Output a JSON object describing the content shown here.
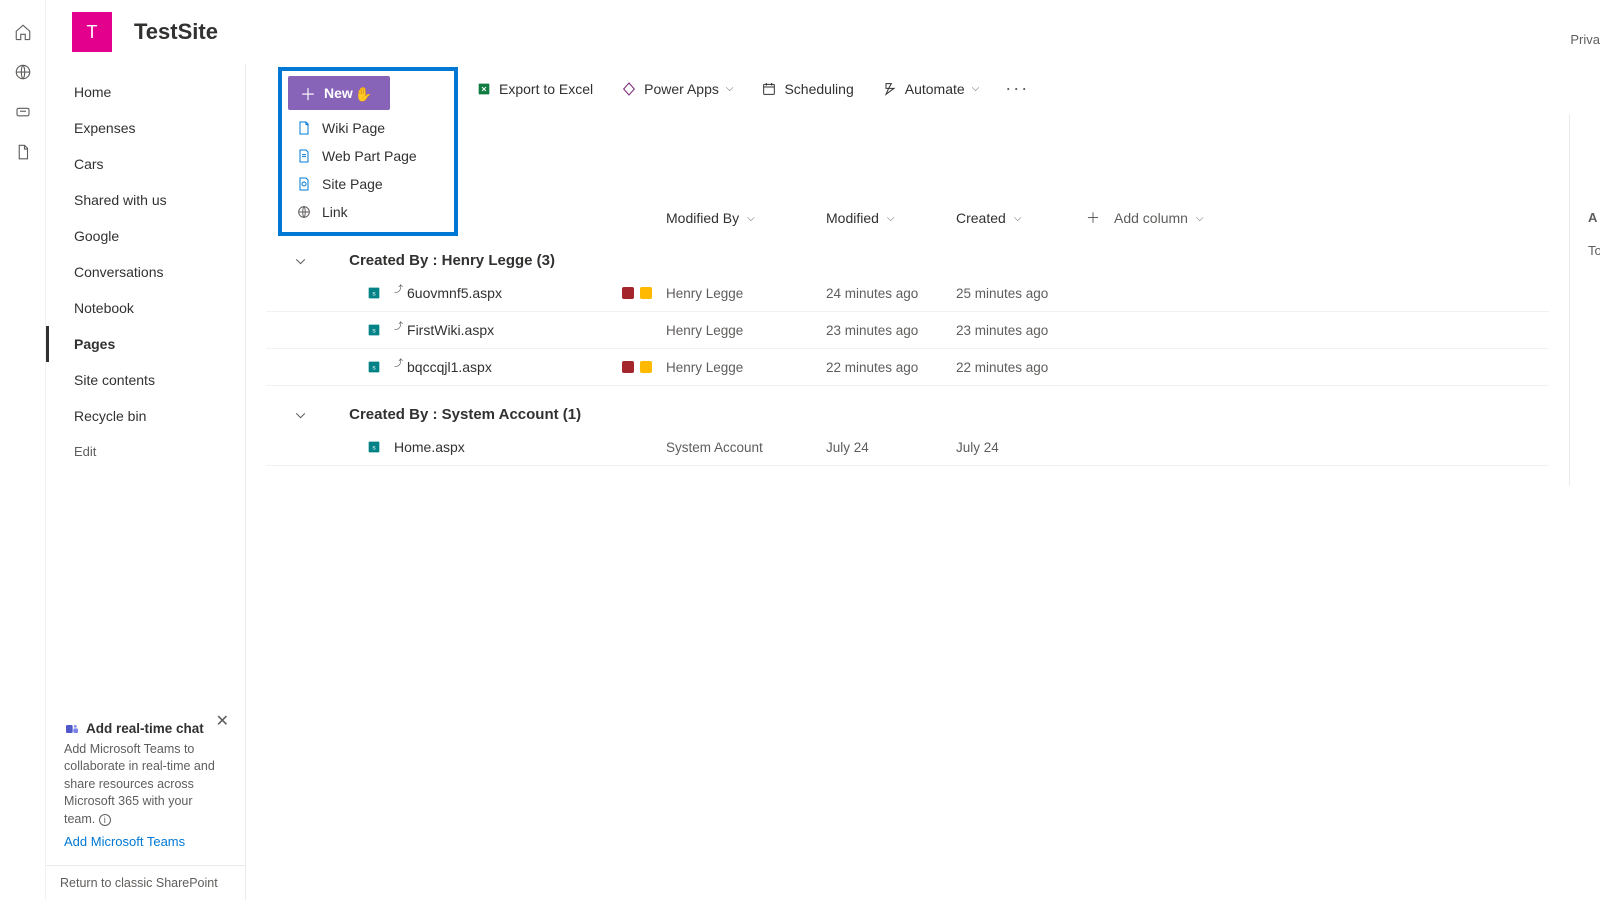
{
  "header": {
    "logo_letter": "T",
    "site_title": "TestSite",
    "privacy": "Priva"
  },
  "rail_icons": [
    "home",
    "globe",
    "link",
    "file"
  ],
  "sidebar": {
    "items": [
      {
        "label": "Home"
      },
      {
        "label": "Expenses"
      },
      {
        "label": "Cars"
      },
      {
        "label": "Shared with us"
      },
      {
        "label": "Google"
      },
      {
        "label": "Conversations"
      },
      {
        "label": "Notebook"
      },
      {
        "label": "Pages",
        "selected": true
      },
      {
        "label": "Site contents"
      },
      {
        "label": "Recycle bin"
      }
    ],
    "edit": "Edit",
    "tip_title": "Add real-time chat",
    "tip_body": "Add Microsoft Teams to collaborate in real-time and share resources across Microsoft 365 with your team.",
    "tip_link": "Add Microsoft Teams",
    "classic": "Return to classic SharePoint"
  },
  "cmd": {
    "new": "New",
    "excel": "Export to Excel",
    "powerapps": "Power Apps",
    "scheduling": "Scheduling",
    "automate": "Automate"
  },
  "new_menu": [
    {
      "label": "Wiki Page"
    },
    {
      "label": "Web Part Page"
    },
    {
      "label": "Site Page"
    },
    {
      "label": "Link"
    }
  ],
  "columns": {
    "name": "",
    "modified_by": "Modified By",
    "modified": "Modified",
    "created": "Created",
    "add": "Add column"
  },
  "groups": [
    {
      "header": "Created By : Henry Legge (3)",
      "rows": [
        {
          "file": "6uovmnf5.aspx",
          "by": "Henry Legge",
          "mod": "24 minutes ago",
          "crt": "25 minutes ago",
          "flags": true
        },
        {
          "file": "FirstWiki.aspx",
          "by": "Henry Legge",
          "mod": "23 minutes ago",
          "crt": "23 minutes ago",
          "flags": false
        },
        {
          "file": "bqccqjl1.aspx",
          "by": "Henry Legge",
          "mod": "22 minutes ago",
          "crt": "22 minutes ago",
          "flags": true
        }
      ]
    },
    {
      "header": "Created By : System Account (1)",
      "rows": [
        {
          "file": "Home.aspx",
          "by": "System Account",
          "mod": "July 24",
          "crt": "July 24",
          "flags": false
        }
      ]
    }
  ],
  "rpanel": {
    "a": "A",
    "t": "To"
  }
}
